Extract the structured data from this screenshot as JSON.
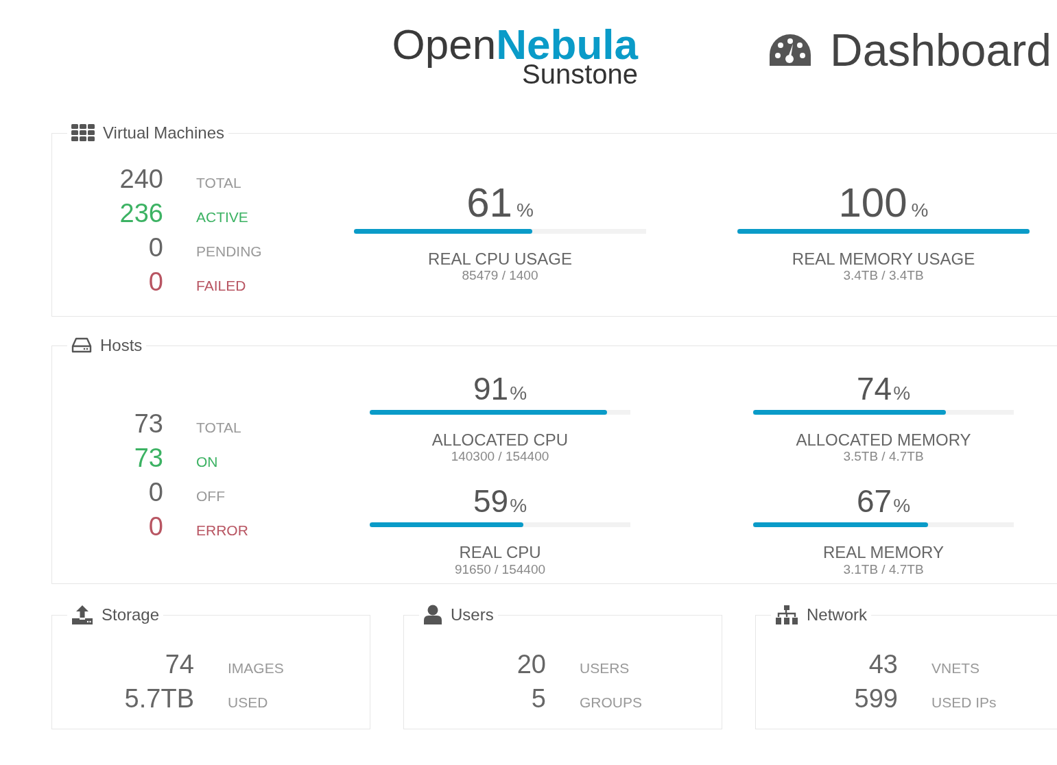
{
  "header": {
    "logo": {
      "open": "Open",
      "nebula": "Nebula",
      "product": "Sunstone"
    },
    "title": "Dashboard"
  },
  "vms": {
    "title": "Virtual Machines",
    "stats": [
      {
        "value": "240",
        "label": "TOTAL",
        "kind": "neutral"
      },
      {
        "value": "236",
        "label": "ACTIVE",
        "kind": "good"
      },
      {
        "value": "0",
        "label": "PENDING",
        "kind": "neutral"
      },
      {
        "value": "0",
        "label": "FAILED",
        "kind": "bad"
      }
    ],
    "meters": [
      {
        "value": "61",
        "unit": "%",
        "level": 0.61,
        "label": "REAL CPU USAGE",
        "detail": "85479 / 1400"
      },
      {
        "value": "100",
        "unit": "%",
        "level": 1.0,
        "label": "REAL MEMORY USAGE",
        "detail": "3.4TB / 3.4TB"
      }
    ]
  },
  "hosts": {
    "title": "Hosts",
    "stats": [
      {
        "value": "73",
        "label": "TOTAL",
        "kind": "neutral"
      },
      {
        "value": "73",
        "label": "ON",
        "kind": "good"
      },
      {
        "value": "0",
        "label": "OFF",
        "kind": "neutral"
      },
      {
        "value": "0",
        "label": "ERROR",
        "kind": "bad"
      }
    ],
    "meters": [
      {
        "value": "91",
        "unit": "%",
        "level": 0.91,
        "label": "ALLOCATED CPU",
        "detail": "140300 / 154400"
      },
      {
        "value": "74",
        "unit": "%",
        "level": 0.74,
        "label": "ALLOCATED MEMORY",
        "detail": "3.5TB / 4.7TB"
      },
      {
        "value": "59",
        "unit": "%",
        "level": 0.59,
        "label": "REAL CPU",
        "detail": "91650 / 154400"
      },
      {
        "value": "67",
        "unit": "%",
        "level": 0.67,
        "label": "REAL MEMORY",
        "detail": "3.1TB / 4.7TB"
      }
    ]
  },
  "panels": [
    {
      "kind": "storage",
      "title": "Storage",
      "stats": [
        {
          "value": "74",
          "label": "IMAGES"
        },
        {
          "value": "5.7TB",
          "label": "USED"
        }
      ]
    },
    {
      "kind": "users",
      "title": "Users",
      "stats": [
        {
          "value": "20",
          "label": "USERS"
        },
        {
          "value": "5",
          "label": "GROUPS"
        }
      ]
    },
    {
      "kind": "network",
      "title": "Network",
      "stats": [
        {
          "value": "43",
          "label": "VNETS"
        },
        {
          "value": "599",
          "label": "USED IPs"
        }
      ]
    }
  ]
}
